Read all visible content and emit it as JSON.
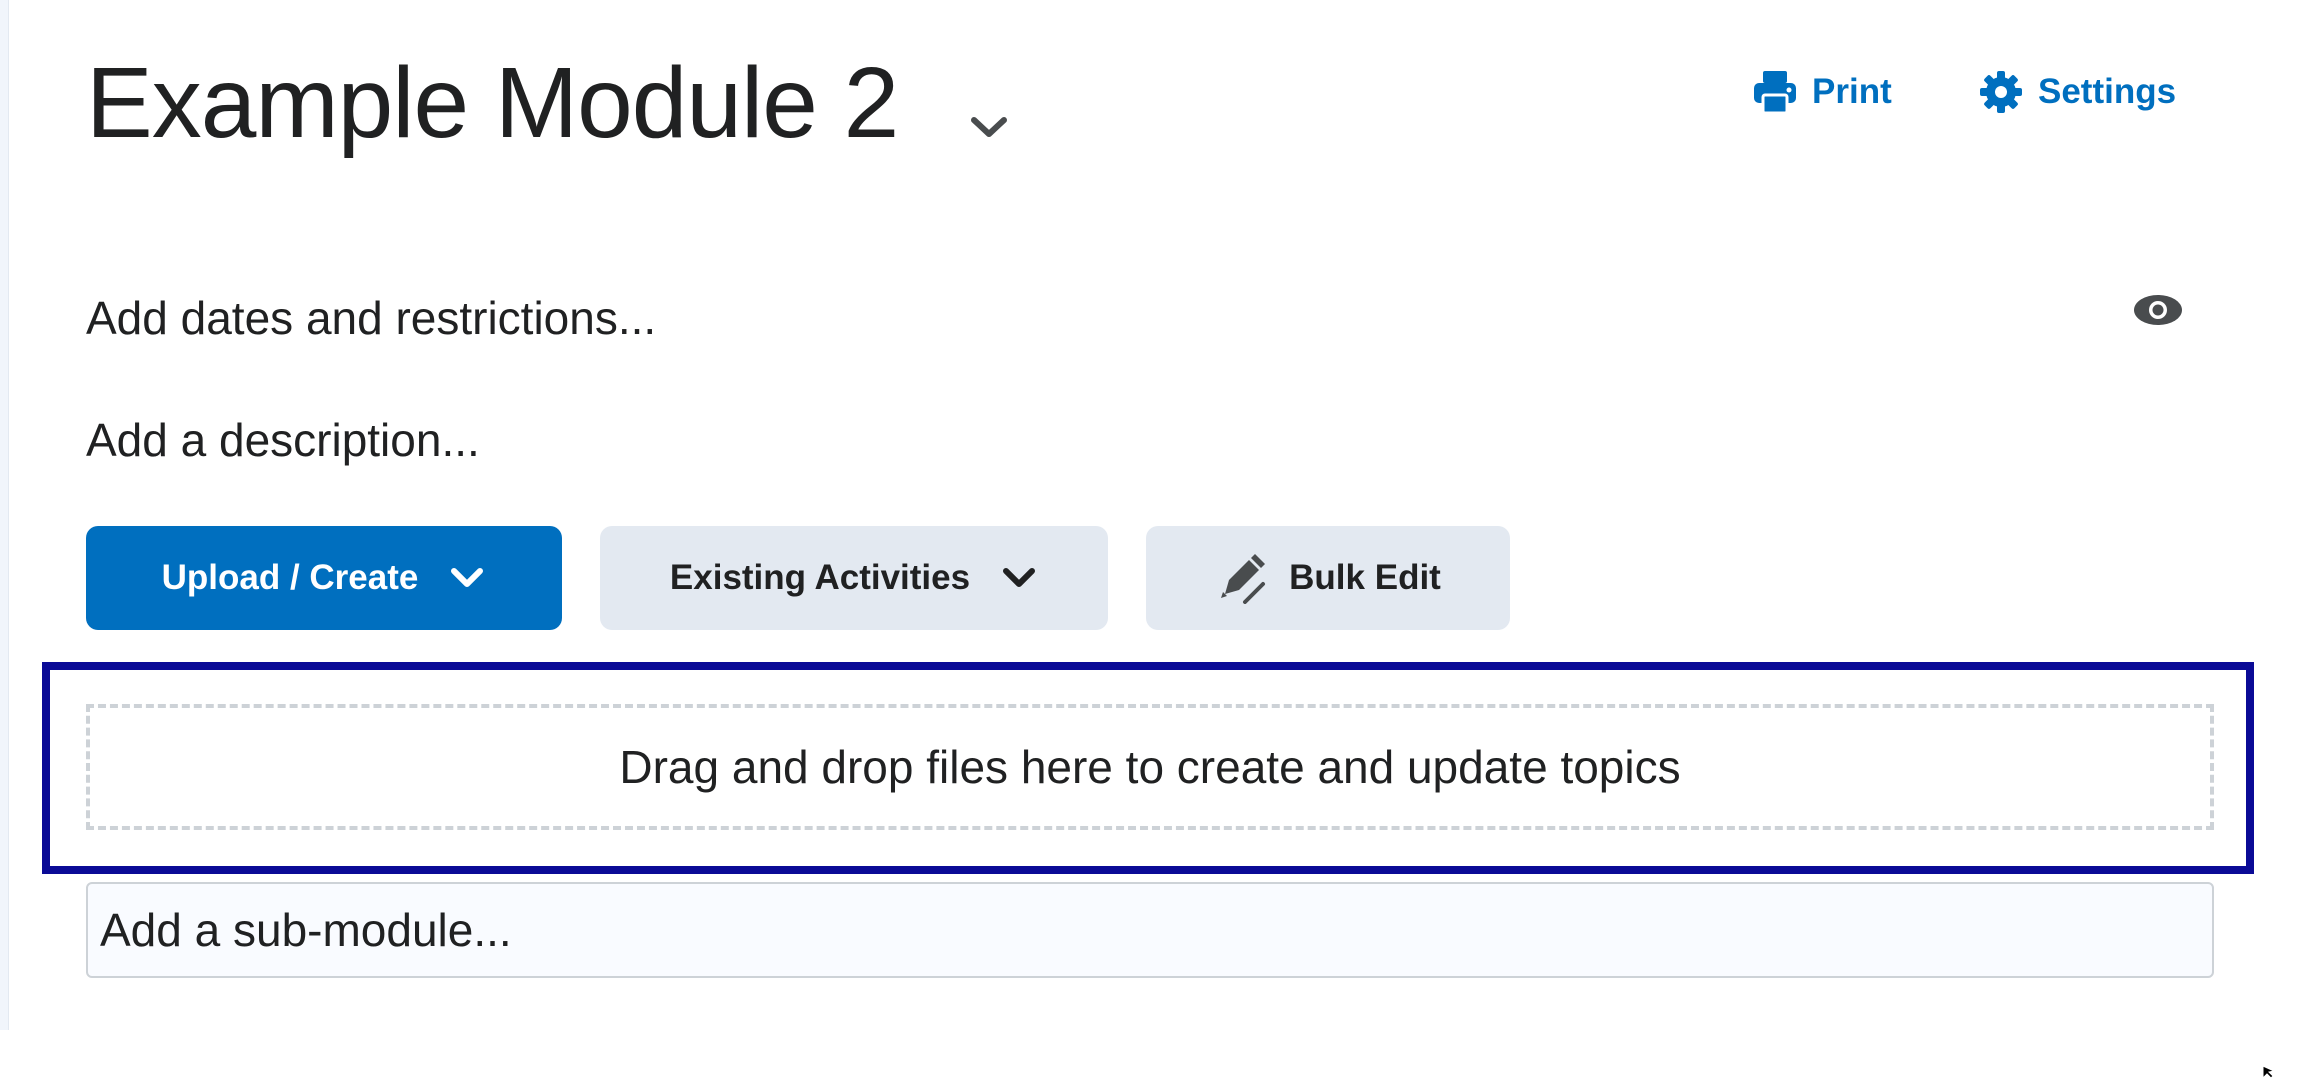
{
  "module": {
    "title": "Example Module 2"
  },
  "header_actions": {
    "print_label": "Print",
    "settings_label": "Settings"
  },
  "placeholders": {
    "dates": "Add dates and restrictions...",
    "description": "Add a description...",
    "submodule": "Add a sub-module..."
  },
  "toolbar": {
    "upload_create_label": "Upload / Create",
    "existing_activities_label": "Existing Activities",
    "bulk_edit_label": "Bulk Edit"
  },
  "drop_zone": {
    "text": "Drag and drop files here to create and update topics"
  },
  "icons": {
    "title_menu": "chevron-down-icon",
    "print": "printer-icon",
    "settings": "gear-icon",
    "visibility": "eye-icon",
    "upload_chevron": "chevron-down-icon",
    "existing_chevron": "chevron-down-icon",
    "bulk_edit": "pencil-icon"
  },
  "colors": {
    "accent": "#006fbf",
    "secondary_button_bg": "#e3e9f1",
    "highlight_border": "#0a0a96",
    "text": "#202122"
  }
}
